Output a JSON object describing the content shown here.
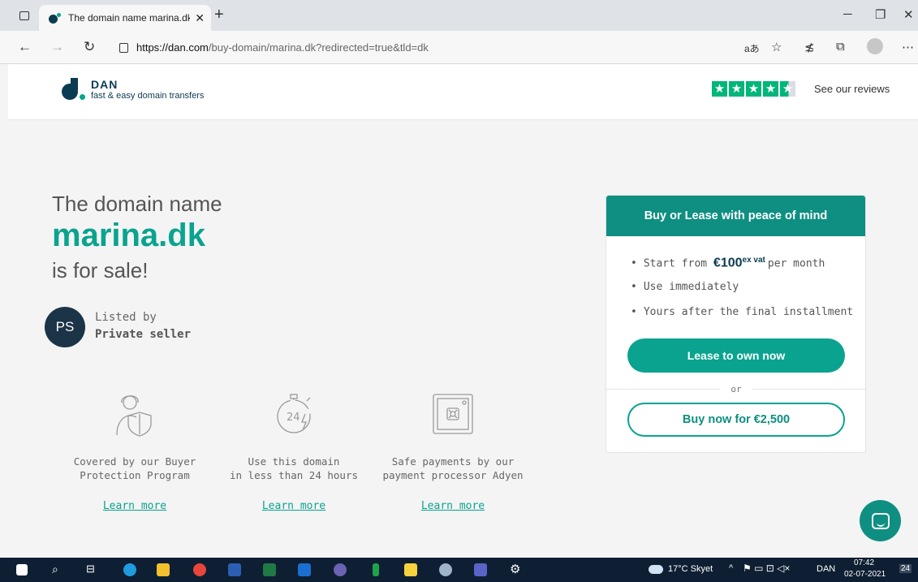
{
  "browser": {
    "tab_title": "The domain name marina.dk is fo",
    "tab_close": "✕",
    "new_tab": "+",
    "url_host": "https://dan.com",
    "url_path": "/buy-domain/marina.dk?redirected=true&tld=dk",
    "window_controls": [
      "─",
      "❐",
      "✕"
    ]
  },
  "header": {
    "brand": "DAN",
    "tagline": "fast & easy domain transfers",
    "stars": [
      "★",
      "★",
      "★",
      "★",
      "★"
    ],
    "reviews_label": "See our reviews"
  },
  "hero": {
    "line1": "The domain name",
    "domain": "marina.dk",
    "line3": "is for sale!"
  },
  "seller": {
    "initials": "PS",
    "listed_by": "Listed by",
    "name": "Private seller"
  },
  "features": [
    {
      "icon": "shield-person-icon",
      "text1": "Covered by our Buyer",
      "text2": "Protection Program",
      "link": "Learn more"
    },
    {
      "icon": "stopwatch-24-icon",
      "text1": "Use this domain",
      "text2": "in less than 24 hours",
      "link": "Learn more"
    },
    {
      "icon": "safe-icon",
      "text1": "Safe payments by our",
      "text2": "payment processor Adyen",
      "link": "Learn more"
    }
  ],
  "card": {
    "heading": "Buy or Lease with peace of mind",
    "start_prefix": "Start from ",
    "price": "€100",
    "price_sup": "ex vat",
    "price_suffix": "per month",
    "bullet2": "Use immediately",
    "bullet3": "Yours after the final installment",
    "lease_button": "Lease to own now",
    "or": "or",
    "buy_button": "Buy now for €2,500"
  },
  "taskbar": {
    "weather": "17°C Skyet",
    "lang": "DAN",
    "time": "07:42",
    "date": "02-07-2021",
    "notifications": "24"
  },
  "colors": {
    "accent": "#0aa38f",
    "accent_dark": "#0e8f82",
    "brand_navy": "#0b3b52",
    "trustpilot": "#00b67a"
  }
}
